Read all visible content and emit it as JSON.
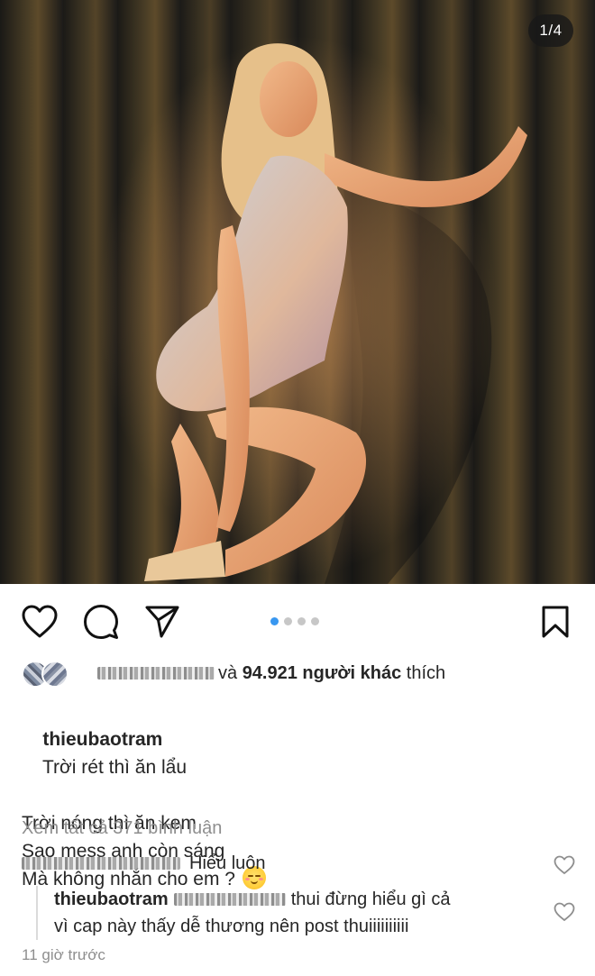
{
  "post": {
    "image_counter": "1/4",
    "carousel": {
      "count": 4,
      "active_index": 0
    }
  },
  "colors": {
    "accent_dot": "#3897f0",
    "inactive_dot": "#c7c7c7",
    "text_primary": "#262626",
    "text_secondary": "#8e8e8e"
  },
  "icons": {
    "like": "heart-outline-icon",
    "comment": "comment-bubble-icon",
    "share": "paper-plane-icon",
    "save": "bookmark-icon"
  },
  "likes": {
    "prefix": "và ",
    "count_text": "94.921 người khác",
    "suffix": " thích"
  },
  "caption": {
    "username": "thieubaotram",
    "lines": [
      "Trời rét thì ăn lẩu",
      "Trời nóng thì ăn kem",
      "Sao mess anh còn sáng",
      "Mà không nhắn cho em ?"
    ]
  },
  "view_all_comments": "Xem tất cả 371 bình luận",
  "comments": [
    {
      "text": "Hiểu luôn"
    },
    {
      "username": "thieubaotram",
      "text_line1": "thui đừng hiểu gì cả",
      "text_line2": "vì cap này thấy dễ thương nên post thuiiiiiiiiii"
    }
  ],
  "timestamp": "11 giờ trước"
}
